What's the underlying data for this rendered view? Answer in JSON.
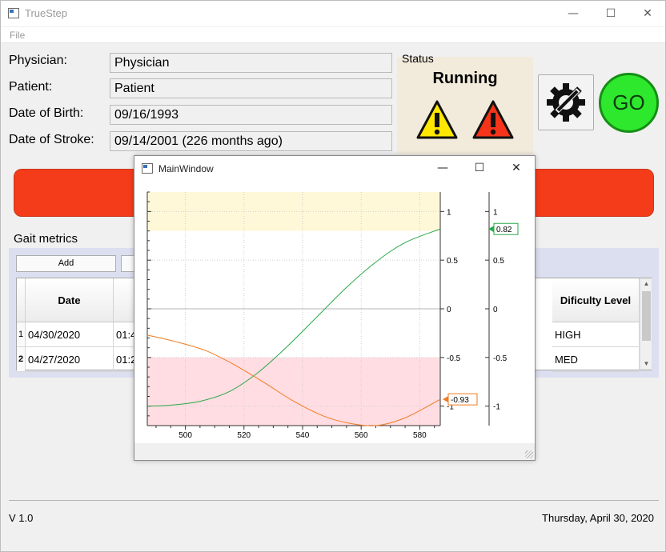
{
  "window": {
    "title": "TrueStep",
    "controls": {
      "minimize": "—",
      "maximize": "☐",
      "close": "✕"
    }
  },
  "menu": {
    "file": "File"
  },
  "form": {
    "physician_label": "Physician:",
    "physician_value": "Physician",
    "patient_label": "Patient:",
    "patient_value": "Patient",
    "dob_label": "Date of Birth:",
    "dob_value": "09/16/1993",
    "stroke_label": "Date of Stroke:",
    "stroke_value": "09/14/2001 (226 months ago)"
  },
  "status": {
    "label": "Status",
    "value": "Running"
  },
  "go_label": "GO",
  "gait": {
    "label": "Gait metrics",
    "add_label": "Add",
    "columns": {
      "date": "Date",
      "difficulty": "Dificulty Level"
    },
    "rows": [
      {
        "num": "1",
        "date": "04/30/2020",
        "time": "01:4",
        "level": "HIGH"
      },
      {
        "num": "2",
        "date": "04/27/2020",
        "time": "01:2",
        "level": "MED"
      }
    ]
  },
  "footer": {
    "version": "V 1.0",
    "date": "Thursday, April 30, 2020"
  },
  "plot_window": {
    "title": "MainWindow",
    "controls": {
      "minimize": "—",
      "maximize": "☐",
      "close": "✕"
    }
  },
  "chart_data": {
    "type": "line",
    "title": "",
    "x_ticks": [
      500,
      520,
      540,
      560,
      580
    ],
    "y_ticks": [
      1,
      0.5,
      0,
      -0.5,
      -1
    ],
    "y_tick_labels": [
      "1",
      "0.5",
      "0",
      "-0.5",
      "-1"
    ],
    "xlim": [
      487,
      587
    ],
    "ylim": [
      -1.2,
      1.2
    ],
    "grid": true,
    "bands": [
      {
        "from": 0.8,
        "to": 1.2,
        "color": "#fff8d8"
      },
      {
        "from": -1.2,
        "to": -0.5,
        "color": "#ffdde2"
      }
    ],
    "series": [
      {
        "color": "#2aa84a",
        "x": [
          487,
          495,
          505,
          515,
          525,
          535,
          545,
          555,
          565,
          575,
          587
        ],
        "values": [
          -1.0,
          -0.99,
          -0.95,
          -0.85,
          -0.65,
          -0.38,
          -0.08,
          0.22,
          0.48,
          0.68,
          0.82
        ]
      },
      {
        "color": "#f07b20",
        "x": [
          487,
          497,
          507,
          517,
          527,
          537,
          547,
          555,
          565,
          575,
          587
        ],
        "values": [
          -0.27,
          -0.34,
          -0.43,
          -0.58,
          -0.76,
          -0.95,
          -1.1,
          -1.17,
          -1.2,
          -1.12,
          -0.93
        ]
      }
    ],
    "end_labels": [
      "0.82",
      "-0.93"
    ]
  }
}
